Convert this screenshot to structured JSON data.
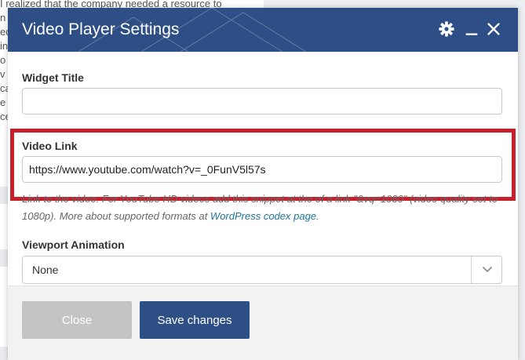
{
  "background": {
    "lines": [
      "I realized that the company needed a resource to",
      "n t",
      "ed",
      " in",
      "o",
      " v",
      "ca",
      "e",
      "ce"
    ]
  },
  "modal": {
    "title": "Video Player Settings",
    "icons": {
      "settings": "gear-icon",
      "minimize": "minimize-icon",
      "close": "close-icon"
    },
    "widget_title": {
      "label": "Widget Title",
      "value": ""
    },
    "video_link": {
      "label": "Video Link",
      "value": "https://www.youtube.com/watch?v=_0FunV5l57s",
      "help_text": "Link to the video. For YouTube HD videos add this snippet at the of a link \"&vq=1080\" (video quality set to 1080p). More about supported formats at ",
      "help_link": "WordPress codex page",
      "help_suffix": "."
    },
    "viewport_animation": {
      "label": "Viewport Animation",
      "selected": "None"
    },
    "footer": {
      "close_label": "Close",
      "save_label": "Save changes"
    }
  },
  "colors": {
    "header": "#2e4f86",
    "save_button": "#2e4f86",
    "close_button": "#c4c4c4",
    "highlight": "#c8202a",
    "link": "#21759b"
  }
}
